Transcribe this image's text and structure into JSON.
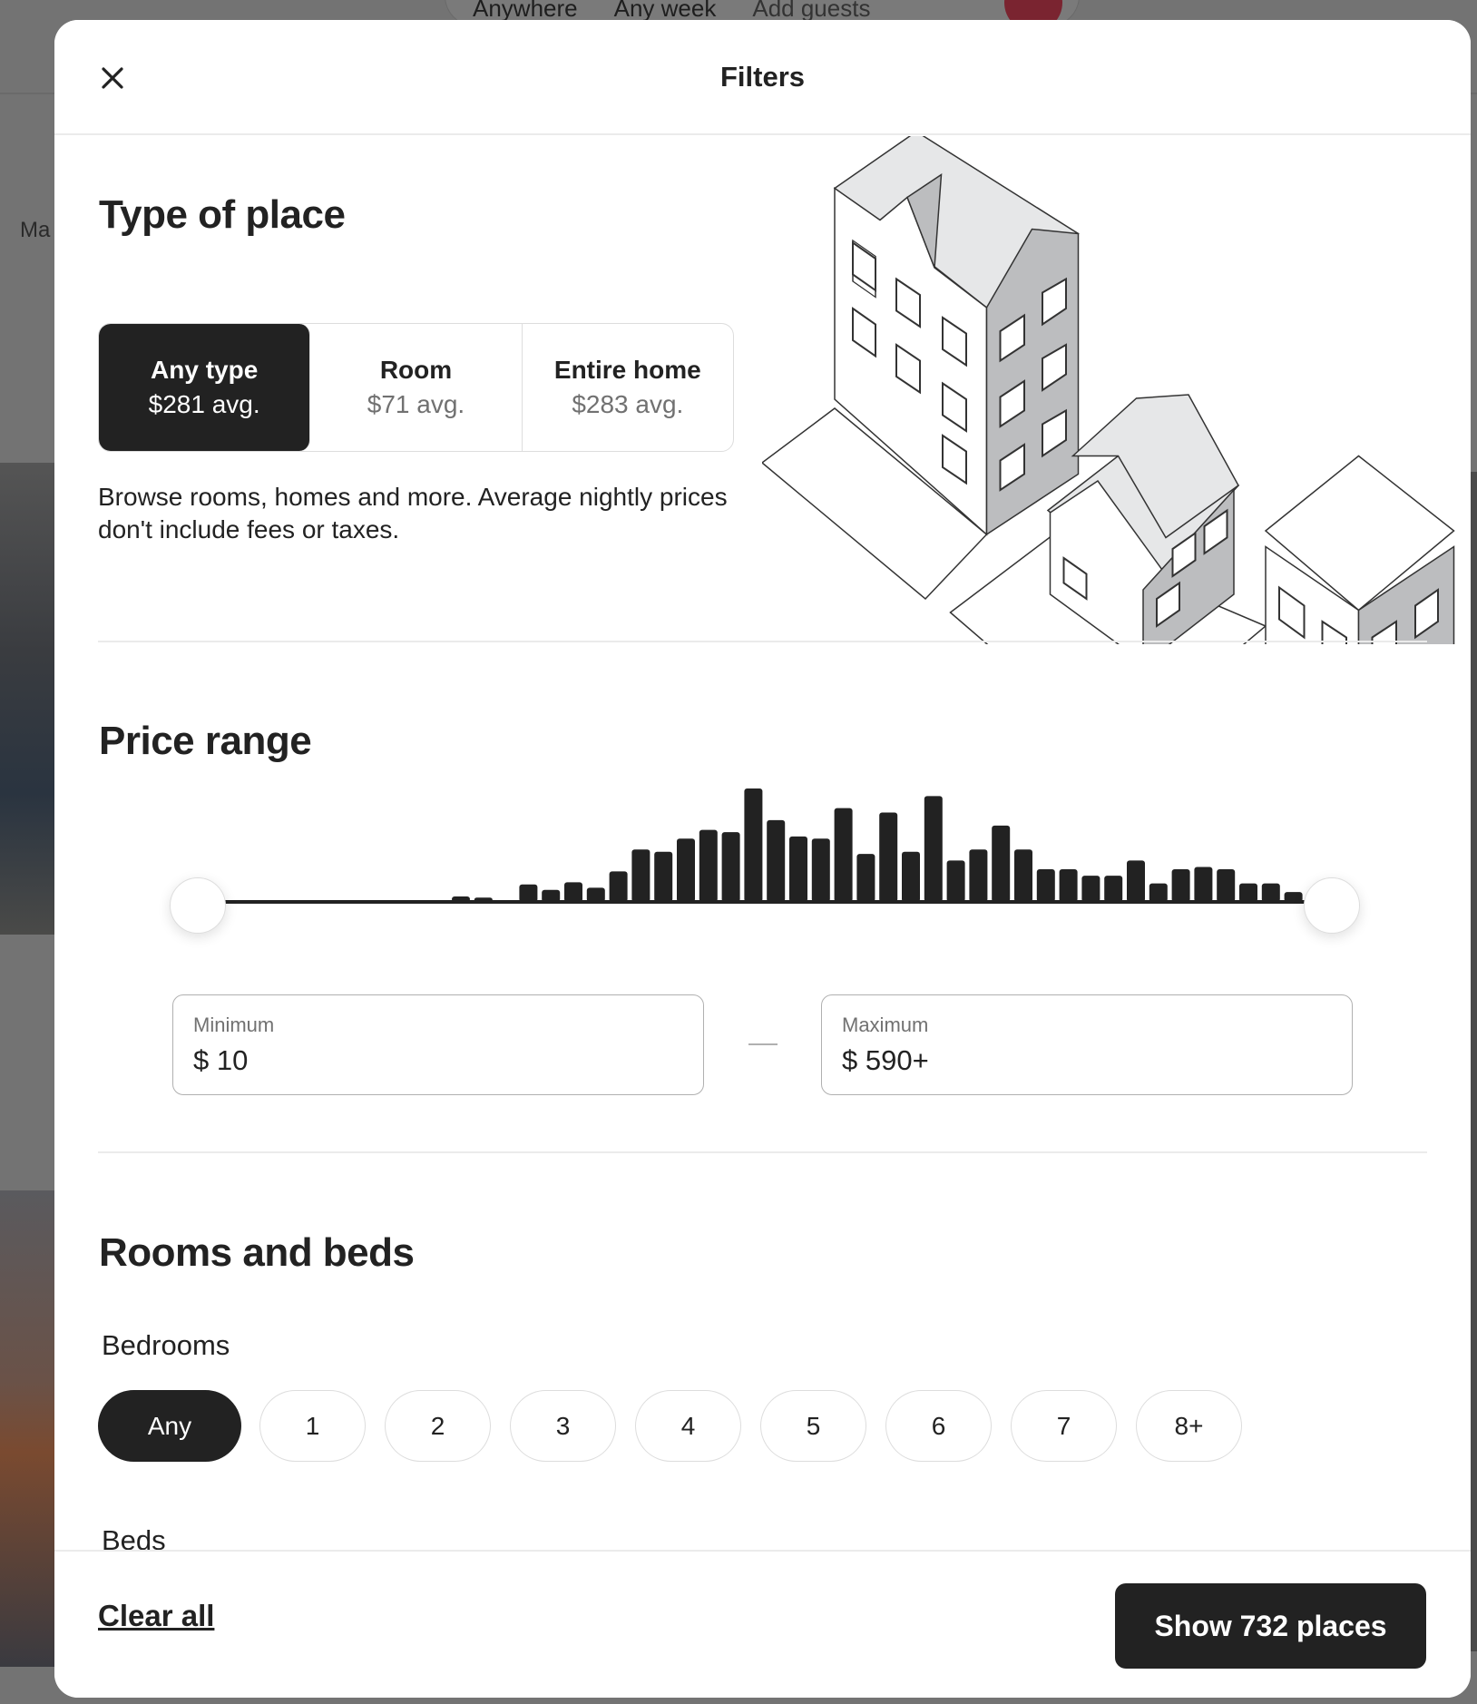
{
  "background": {
    "search_items": [
      "Anywhere",
      "Any week",
      "Add guests"
    ],
    "category_partial": "Ma"
  },
  "header": {
    "title": "Filters",
    "close_icon": "close-icon"
  },
  "type_of_place": {
    "title": "Type of place",
    "options": [
      {
        "label": "Any type",
        "price": "$281 avg.",
        "selected": true
      },
      {
        "label": "Room",
        "price": "$71 avg.",
        "selected": false
      },
      {
        "label": "Entire home",
        "price": "$283 avg.",
        "selected": false
      }
    ],
    "description": "Browse rooms, homes and more. Average nightly prices don't include fees or taxes."
  },
  "price_range": {
    "title": "Price range",
    "histogram": [
      0,
      0,
      0,
      0,
      0,
      0,
      0,
      0,
      0,
      0,
      5,
      4,
      0,
      16,
      11,
      18,
      13,
      28,
      48,
      46,
      58,
      66,
      64,
      104,
      75,
      60,
      58,
      86,
      44,
      82,
      46,
      97,
      38,
      48,
      70,
      48,
      30,
      30,
      24,
      24,
      38,
      17,
      30,
      32,
      30,
      17,
      17,
      9,
      4
    ],
    "minimum": {
      "label": "Minimum",
      "currency": "$",
      "value": "10"
    },
    "maximum": {
      "label": "Maximum",
      "currency": "$",
      "value": "590+"
    },
    "colors": {
      "bars": "#222222"
    }
  },
  "rooms_and_beds": {
    "title": "Rooms and beds",
    "bedrooms": {
      "label": "Bedrooms",
      "options": [
        "Any",
        "1",
        "2",
        "3",
        "4",
        "5",
        "6",
        "7",
        "8+"
      ],
      "selected": "Any"
    },
    "beds": {
      "label": "Beds"
    }
  },
  "footer": {
    "clear_all": "Clear all",
    "show_button": "Show 732 places"
  }
}
